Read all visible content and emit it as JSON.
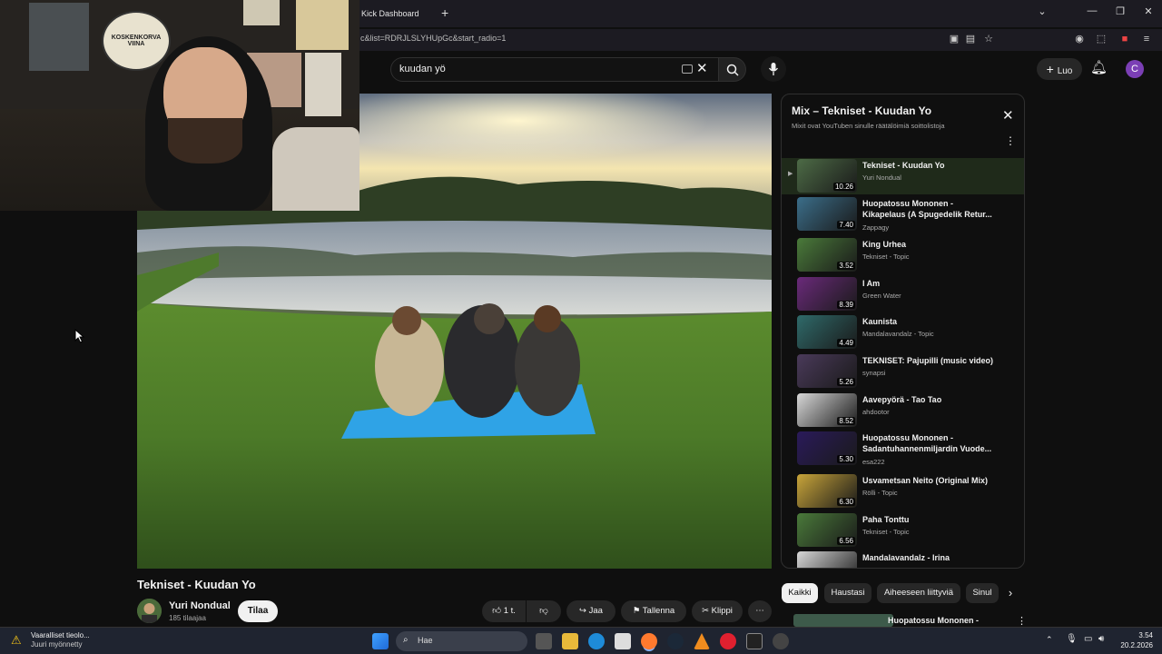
{
  "browser": {
    "tab_title": "Kick Dashboard",
    "url": "c&list=RDRJLSLYHUpGc&start_radio=1"
  },
  "header": {
    "search_value": "kuudan yö",
    "create_label": "Luo",
    "avatar_letter": "C"
  },
  "player": {
    "title": "Tekniset - Kuudan Yo",
    "channel": "Yuri Nondual",
    "subscribers": "185 tilaajaa",
    "subscribe_label": "Tilaa",
    "like_count": "1 t.",
    "share_label": "Jaa",
    "save_label": "Tallenna",
    "clip_label": "Klippi"
  },
  "playlist": {
    "title": "Mix – Tekniset - Kuudan Yo",
    "subtitle": "Mixit ovat YouTuben sinulle räätälöimiä soittolistoja",
    "items": [
      {
        "title": "Tekniset - Kuudan Yo",
        "channel": "Yuri Nondual",
        "duration": "10.26"
      },
      {
        "title": "Huopatossu Mononen - Kikapelaus (A Spugedelik Retur...",
        "channel": "Zappagy",
        "duration": "7.40"
      },
      {
        "title": "King Urhea",
        "channel": "Tekniset - Topic",
        "duration": "3.52"
      },
      {
        "title": "I Am",
        "channel": "Green Water",
        "duration": "8.39"
      },
      {
        "title": "Kaunista",
        "channel": "Mandalavandalz - Topic",
        "duration": "4.49"
      },
      {
        "title": "TEKNISET: Pajupilli (music video)",
        "channel": "synapsi",
        "duration": "5.26"
      },
      {
        "title": "Aavepyörä - Tao Tao",
        "channel": "ahdootor",
        "duration": "8.52"
      },
      {
        "title": "Huopatossu Mononen - Sadantuhannenmiljardin Vuode...",
        "channel": "esa222",
        "duration": "5.30"
      },
      {
        "title": "Usvametsan Neito (Original Mix)",
        "channel": "Rölli - Topic",
        "duration": "6.30"
      },
      {
        "title": "Paha Tonttu",
        "channel": "Tekniset - Topic",
        "duration": "6.56"
      },
      {
        "title": "Mandalavandalz - Irina",
        "channel": "",
        "duration": ""
      }
    ]
  },
  "chips": [
    "Kaikki",
    "Haustasi",
    "Aiheeseen liittyviä",
    "Sinul"
  ],
  "next_item": "Huopatossu Mononen -",
  "webcam_text": {
    "sign": "KOSKENKORVA VIINA"
  },
  "taskbar": {
    "notification_title": "Vaaralliset tieolo...",
    "notification_sub": "Juuri myönnetty",
    "search_placeholder": "Hae",
    "time": "3.54",
    "date": "20.2.2026"
  }
}
